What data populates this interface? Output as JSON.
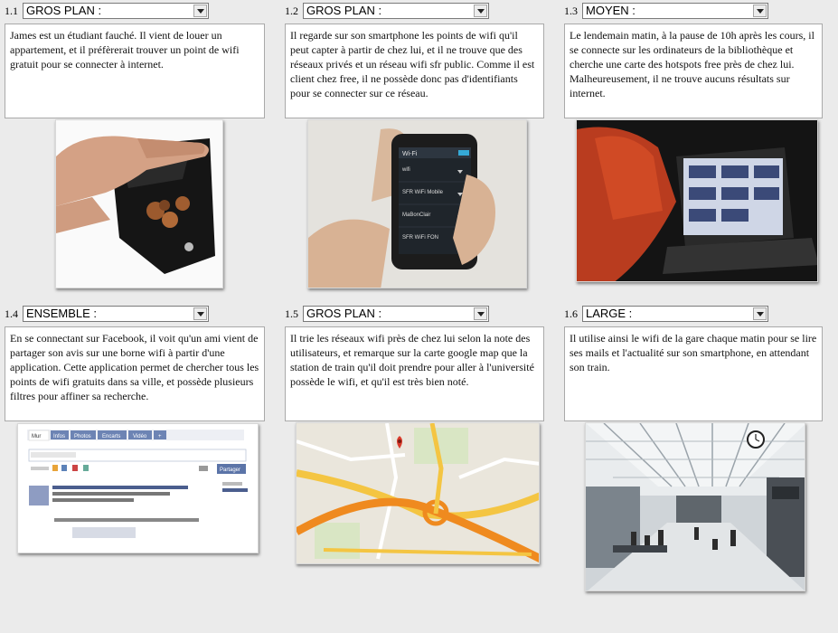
{
  "panels": [
    {
      "number": "1.1",
      "shot": "GROS PLAN :",
      "text": "James est un étudiant fauché. Il vient de louer un appartement, et il préfèrerait trouver un point de wifi gratuit pour se connecter à internet."
    },
    {
      "number": "1.2",
      "shot": "GROS PLAN :",
      "text": "Il regarde sur son smartphone les points de wifi qu'il peut capter à partir de chez lui, et il ne trouve que des réseaux privés et un réseau wifi sfr public. Comme il est client chez free, il ne possède donc pas d'identifiants pour se connecter sur ce réseau."
    },
    {
      "number": "1.3",
      "shot": "MOYEN :",
      "text": "Le lendemain matin, à la pause de 10h après les cours, il se connecte sur les ordinateurs de la bibliothèque et cherche une carte des hotspots free près de chez lui. Malheureusement, il ne trouve aucuns résultats sur internet."
    },
    {
      "number": "1.4",
      "shot": "ENSEMBLE :",
      "text": "En se connectant sur Facebook, il voit qu'un ami vient de partager son avis sur une borne wifi à partir d'une application. Cette application permet de chercher tous les points de wifi gratuits dans sa ville, et possède plusieurs filtres pour affiner sa recherche."
    },
    {
      "number": "1.5",
      "shot": "GROS PLAN :",
      "text": "Il trie les réseaux wifi près de chez lui selon la note des utilisateurs, et remarque sur la carte google map que la station de train qu'il doit prendre pour aller à l'université possède le wifi, et qu'il est très bien noté."
    },
    {
      "number": "1.6",
      "shot": "LARGE :",
      "text": "Il utilise ainsi le wifi de la gare chaque matin pour se lire ses mails et l'actualité sur son smartphone, en attendant son train."
    }
  ],
  "phone": {
    "title": "Wi-Fi",
    "networks": [
      "wifi",
      "SFR WiFi Mobile",
      "MaBonClair",
      "SFR WiFi FON"
    ]
  },
  "facebook": {
    "tabs": [
      "Mur",
      "Infos",
      "Photos",
      "Encarts",
      "Vidéo",
      "+"
    ],
    "share_button": "Partager"
  }
}
